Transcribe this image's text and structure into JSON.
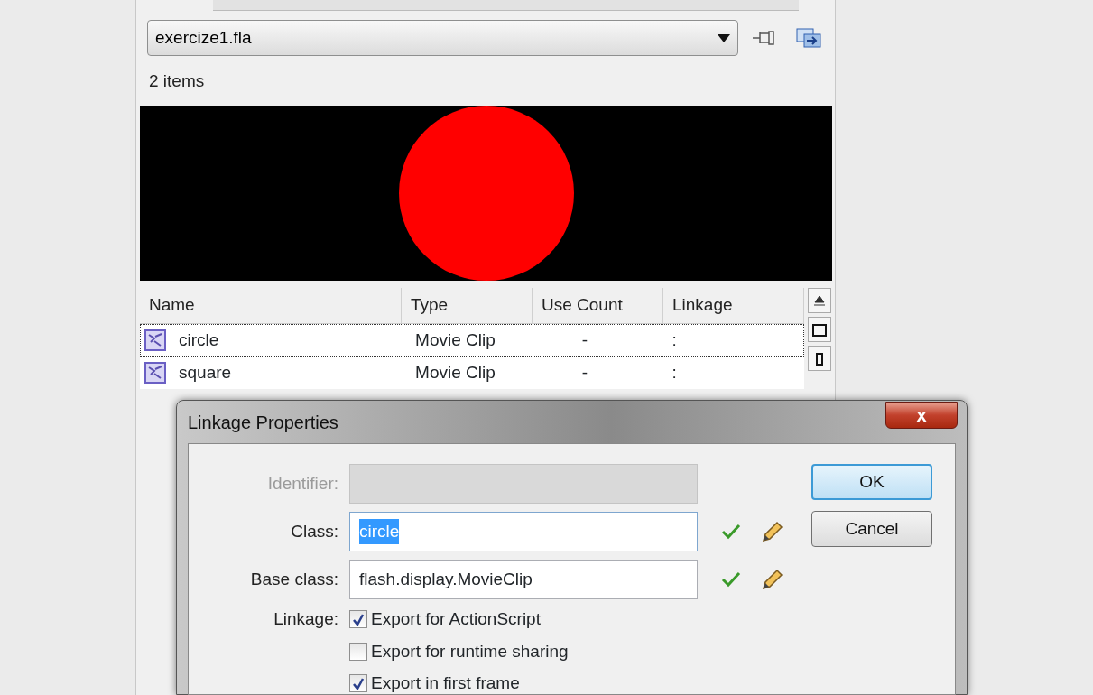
{
  "library": {
    "document": "exercize1.fla",
    "item_count": "2 items",
    "columns": [
      "Name",
      "Type",
      "Use Count",
      "Linkage"
    ],
    "rows": [
      {
        "name": "circle",
        "type": "Movie Clip",
        "use_count": "-",
        "linkage": ":",
        "selected": true
      },
      {
        "name": "square",
        "type": "Movie Clip",
        "use_count": "-",
        "linkage": ":",
        "selected": false
      }
    ]
  },
  "dialog": {
    "title": "Linkage Properties",
    "close": "x",
    "fields": [
      {
        "label": "Identifier:",
        "disabled": true,
        "text_selected": false
      },
      {
        "label": "Class:",
        "value": "circle",
        "disabled": false,
        "text_selected": true
      },
      {
        "label": "Base class:",
        "value": "flash.display.MovieClip",
        "disabled": false,
        "text_selected": false
      }
    ],
    "linkage_label": "Linkage:",
    "options": [
      {
        "label": "Export for ActionScript",
        "checked": true
      },
      {
        "label": "Export for runtime sharing",
        "checked": false
      },
      {
        "label": "Export in first frame",
        "checked": true
      }
    ],
    "buttons": [
      {
        "label": "OK",
        "default": true
      },
      {
        "label": "Cancel",
        "default": false
      }
    ]
  }
}
